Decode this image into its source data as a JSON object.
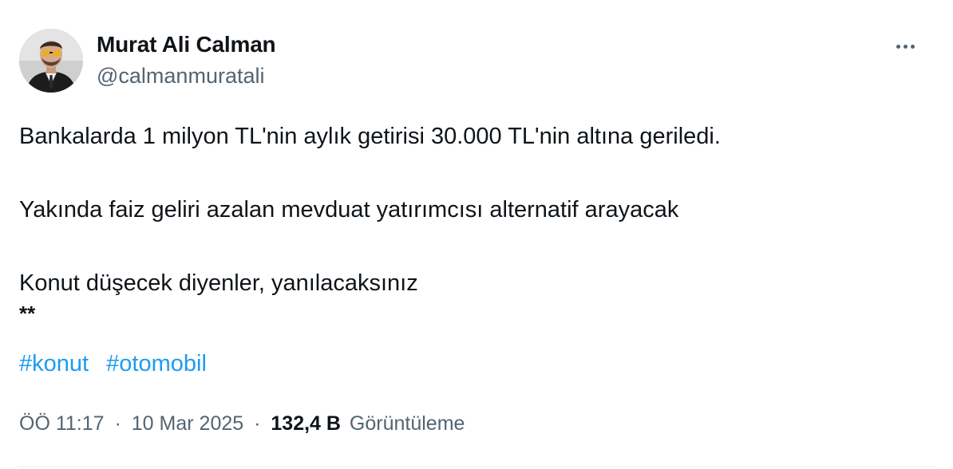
{
  "author": {
    "name": "Murat Ali Calman",
    "handle": "@calmanmuratali",
    "avatar_icon": "profile-photo"
  },
  "tweet": {
    "lines": [
      "Bankalarda 1 milyon TL'nin aylık getirisi 30.000 TL'nin altına geriledi.",
      "",
      "Yakında faiz geliri azalan mevduat yatırımcısı alternatif arayacak",
      "",
      "Konut düşecek diyenler, yanılacaksınız",
      "**"
    ],
    "hashtags": [
      "#konut",
      "#otomobil"
    ]
  },
  "meta": {
    "time": "ÖÖ 11:17",
    "date": "10 Mar 2025",
    "separator": "·",
    "views_count": "132,4 B",
    "views_label": "Görüntüleme"
  },
  "colors": {
    "text": "#0f1419",
    "secondary": "#536471",
    "link": "#1d9bf0",
    "divider": "#eff3f4"
  },
  "icons": {
    "more": "more-horizontal-icon"
  }
}
